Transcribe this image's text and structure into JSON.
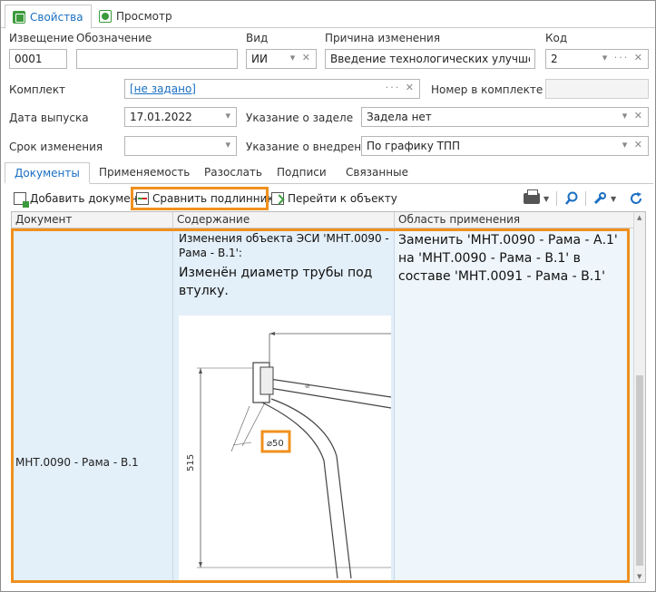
{
  "tabs": [
    {
      "label": "Свойства",
      "icon": "properties-icon"
    },
    {
      "label": "Просмотр",
      "icon": "preview-icon"
    }
  ],
  "form": {
    "notice_label": "Извещение",
    "notice_value": "0001",
    "designation_label": "Обозначение",
    "designation_value": "",
    "type_label": "Вид",
    "type_value": "ИИ",
    "reason_label": "Причина изменения",
    "reason_value": "Введение технологических улучшений и",
    "code_label": "Код",
    "code_value": "2",
    "kit_label": "Комплект",
    "kit_value": "[не задано]",
    "kit_number_label": "Номер в комплекте",
    "kit_number_value": "",
    "release_date_label": "Дата выпуска",
    "release_date_value": "17.01.2022",
    "backlog_label": "Указание о заделе",
    "backlog_value": "Задела нет",
    "change_term_label": "Срок изменения",
    "change_term_value": "",
    "implementation_label": "Указание о внедрении",
    "implementation_value": "По графику ТПП"
  },
  "inner_tabs": [
    "Документы",
    "Применяемость",
    "Разослать",
    "Подписи",
    "Связанные"
  ],
  "toolbar": {
    "add_document": "Добавить документ",
    "compare_originals": "Сравнить подлинники",
    "go_to_object": "Перейти к объекту"
  },
  "grid": {
    "columns": [
      "Документ",
      "Содержание",
      "Область применения"
    ],
    "rows": [
      {
        "document": "МНТ.0090 - Рама - В.1",
        "content_header": "Изменения объекта ЭСИ 'МНТ.0090 - Рама - В.1':",
        "content_body": "Изменён диаметр трубы под втулку.",
        "area": "Заменить 'МНТ.0090 - Рама - А.1' на 'МНТ.0090 - Рама - В.1' в составе 'МНТ.0091 - Рама - В.1'"
      }
    ]
  },
  "drawing": {
    "dimension_diameter": "⌀50",
    "dimension_height": "515"
  },
  "colors": {
    "accent": "#1a6fc2",
    "highlight": "#f0901e",
    "selected_row": "#e3eff9"
  }
}
